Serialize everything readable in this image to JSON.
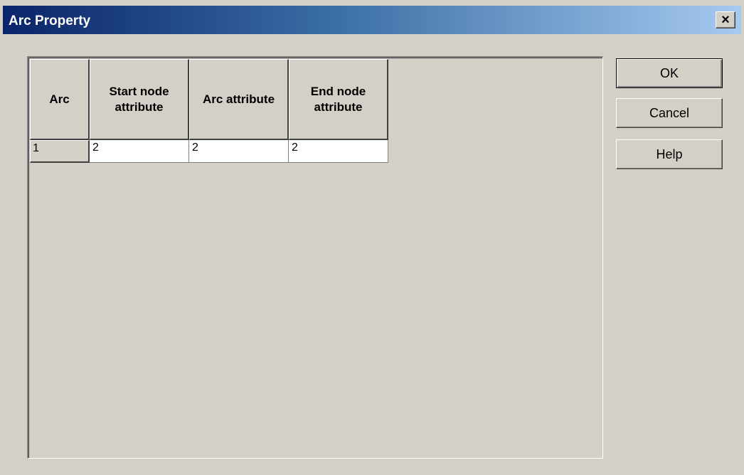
{
  "window": {
    "title": "Arc Property",
    "close_label": "×"
  },
  "table": {
    "columns": [
      "Arc",
      "Start node attribute",
      "Arc attribute",
      "End node attribute"
    ],
    "rows": [
      {
        "arc": "1",
        "start_node_attribute": "2",
        "arc_attribute": "2",
        "end_node_attribute": "2"
      }
    ]
  },
  "buttons": {
    "ok": "OK",
    "cancel": "Cancel",
    "help": "Help"
  }
}
